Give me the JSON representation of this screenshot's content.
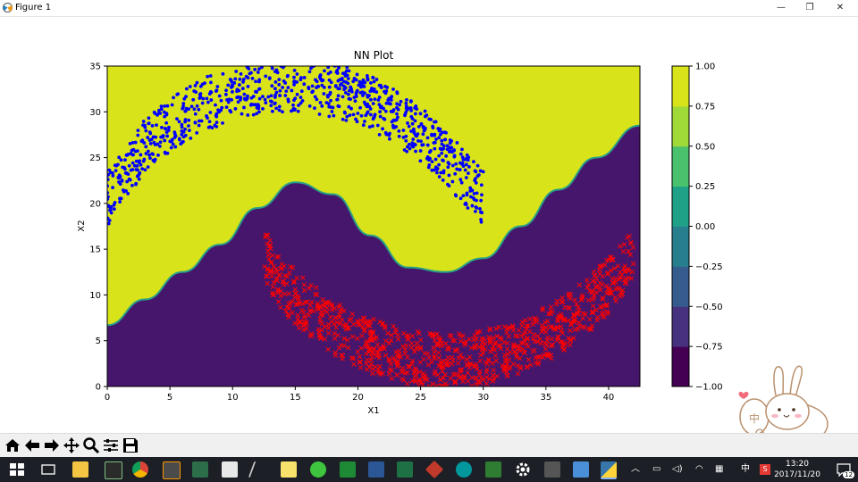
{
  "window": {
    "title": "Figure 1",
    "minimize": "—",
    "maximize": "❐",
    "close": "✕"
  },
  "chart_data": {
    "type": "scatter",
    "title": "NN Plot",
    "xlabel": "X1",
    "ylabel": "X2",
    "xlim": [
      0,
      42.5
    ],
    "ylim": [
      0,
      35
    ],
    "xticks": [
      0,
      5,
      10,
      15,
      20,
      25,
      30,
      35,
      40
    ],
    "yticks": [
      0,
      5,
      10,
      15,
      20,
      25,
      30,
      35
    ],
    "background": "filled contour of the network output (decision regions)",
    "contour_levels": [
      -1.0,
      -0.75,
      -0.5,
      -0.25,
      0.0,
      0.25,
      0.5,
      0.75,
      1.0
    ],
    "colorbar_ticks": [
      "1.00",
      "0.75",
      "0.50",
      "0.25",
      "0.00",
      "−0.25",
      "−0.50",
      "−0.75",
      "−1.00"
    ],
    "colorbar_colors": [
      "#440154",
      "#46327e",
      "#365c8d",
      "#277f8e",
      "#1fa187",
      "#4ac16d",
      "#a0da39",
      "#d9e31a"
    ],
    "decision_boundary": {
      "x": [
        0,
        3,
        6,
        9,
        12,
        15,
        18,
        21,
        24,
        27,
        30,
        33,
        36,
        39,
        42.5
      ],
      "x2": [
        6.7,
        9.5,
        12.5,
        15.5,
        19.5,
        22.3,
        21.0,
        16.5,
        13.0,
        12.5,
        14.0,
        17.5,
        21.5,
        25.0,
        28.5
      ]
    },
    "series": [
      {
        "marker": "dot",
        "color": "#0000ff",
        "shape": "upper half-moon",
        "x": [
          0,
          1,
          2,
          3,
          4,
          5,
          6,
          7,
          8,
          9,
          10,
          11,
          12,
          13,
          14,
          15,
          16,
          17,
          18,
          19,
          20,
          21,
          22,
          23,
          24,
          25,
          26,
          27,
          28,
          29,
          30
        ],
        "x2": [
          20.5,
          22.5,
          24.5,
          26.5,
          27.5,
          28.5,
          29.5,
          30.3,
          31.0,
          31.5,
          32.0,
          32.4,
          32.7,
          32.9,
          33.0,
          33.0,
          32.9,
          32.7,
          32.4,
          32.0,
          31.5,
          31.0,
          30.3,
          29.5,
          28.5,
          27.5,
          26.5,
          25.0,
          23.5,
          22.0,
          20.5
        ]
      },
      {
        "marker": "x",
        "color": "#ff0000",
        "shape": "lower half-moon",
        "x": [
          12.5,
          14,
          16,
          18,
          20,
          22,
          24,
          26,
          28,
          30,
          32,
          34,
          36,
          38,
          40,
          42
        ],
        "x2": [
          14.5,
          11.0,
          8.5,
          6.5,
          5.0,
          4.0,
          3.2,
          2.8,
          2.8,
          3.2,
          4.0,
          5.0,
          6.5,
          8.5,
          11.0,
          14.5
        ]
      }
    ]
  },
  "toolbar": {
    "buttons": [
      "home-icon",
      "back-icon",
      "forward-icon",
      "pan-icon",
      "zoom-icon",
      "configure-subplots-icon",
      "save-icon"
    ]
  },
  "taskbar": {
    "apps": [
      "windows-start-icon",
      "task-view-icon",
      "file-explorer-icon",
      "terminal-icon",
      "chrome-icon",
      "sublime-icon",
      "app-icon",
      "app-icon",
      "pen-icon",
      "notes-icon",
      "wechat-icon",
      "vim-icon",
      "word-icon",
      "excel-icon",
      "app-icon",
      "arduino-icon",
      "app-icon",
      "gear-icon",
      "app-icon",
      "app-icon",
      "python-icon"
    ],
    "tray": {
      "ime": "中",
      "clock_time": "13:20",
      "clock_date": "2017/11/20",
      "notifications": "12"
    }
  },
  "bunny": {
    "label": "中"
  }
}
